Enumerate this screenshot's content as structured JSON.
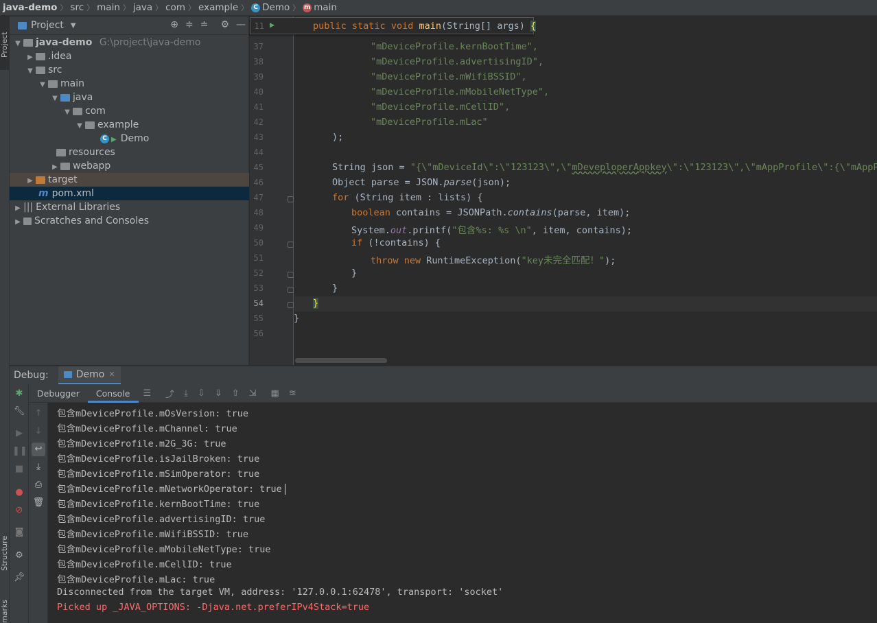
{
  "breadcrumb": [
    "java-demo",
    "src",
    "main",
    "java",
    "com",
    "example",
    "Demo",
    "main"
  ],
  "left_strip": {
    "project_tab": "Project",
    "structure_tab": "Structure",
    "bookmarks_tab": "marks"
  },
  "project": {
    "header": "Project",
    "tree": [
      {
        "label": "java-demo",
        "extra": "G:\\project\\java-demo"
      },
      {
        "label": ".idea"
      },
      {
        "label": "src"
      },
      {
        "label": "main"
      },
      {
        "label": "java"
      },
      {
        "label": "com"
      },
      {
        "label": "example"
      },
      {
        "label": "Demo"
      },
      {
        "label": "resources"
      },
      {
        "label": "webapp"
      },
      {
        "label": "target"
      },
      {
        "label": "pom.xml"
      },
      {
        "label": "External Libraries"
      },
      {
        "label": "Scratches and Consoles"
      }
    ]
  },
  "editor": {
    "sticky": {
      "line": "11",
      "code": "public static void main(String[] args) {"
    },
    "line_numbers": [
      "37",
      "38",
      "39",
      "40",
      "41",
      "42",
      "43",
      "44",
      "45",
      "46",
      "47",
      "48",
      "49",
      "50",
      "51",
      "52",
      "53",
      "54",
      "55",
      "56"
    ],
    "current_line": "54",
    "lines": [
      "\"mDeviceProfile.kernBootTime\",",
      "\"mDeviceProfile.advertisingID\",",
      "\"mDeviceProfile.mWifiBSSID\",",
      "\"mDeviceProfile.mMobileNetType\",",
      "\"mDeviceProfile.mCellID\",",
      "\"mDeviceProfile.mLac\"",
      ");",
      "",
      "String json = \"{\\\"mDeviceId\\\":\\\"123123\\\",\\\"mDeveploperAppkey\\\":\\\"123123\\\",\\\"mAppProfile\\\":{\\\"mAppPac",
      "Object parse = JSON.parse(json);",
      "for (String item : lists) {",
      "boolean contains = JSONPath.contains(parse, item);",
      "System.out.printf(\"包含%s: %s \\n\", item, contains);",
      "if (!contains) {",
      "throw new RuntimeException(\"key未完全匹配！\");",
      "}",
      "}",
      "}",
      "}",
      ""
    ]
  },
  "debug": {
    "label": "Debug:",
    "tab": "Demo",
    "inner_tabs": [
      "Debugger",
      "Console"
    ],
    "active_inner_tab": "Console",
    "console_lines": [
      "包含mDeviceProfile.mOsVersion: true",
      "包含mDeviceProfile.mChannel: true",
      "包含mDeviceProfile.m2G_3G: true",
      "包含mDeviceProfile.isJailBroken: true",
      "包含mDeviceProfile.mSimOperator: true",
      "包含mDeviceProfile.mNetworkOperator: true",
      "包含mDeviceProfile.kernBootTime: true",
      "包含mDeviceProfile.advertisingID: true",
      "包含mDeviceProfile.mWifiBSSID: true",
      "包含mDeviceProfile.mMobileNetType: true",
      "包含mDeviceProfile.mCellID: true",
      "包含mDeviceProfile.mLac: true",
      "Disconnected from the target VM, address: '127.0.0.1:62478', transport: 'socket'",
      "Picked up _JAVA_OPTIONS: -Djava.net.preferIPv4Stack=true"
    ]
  },
  "colors": {
    "keyword": "#cc7832",
    "string": "#6a8759",
    "function": "#ffc66d",
    "error": "#ff6b68",
    "accent": "#4a88c7"
  }
}
